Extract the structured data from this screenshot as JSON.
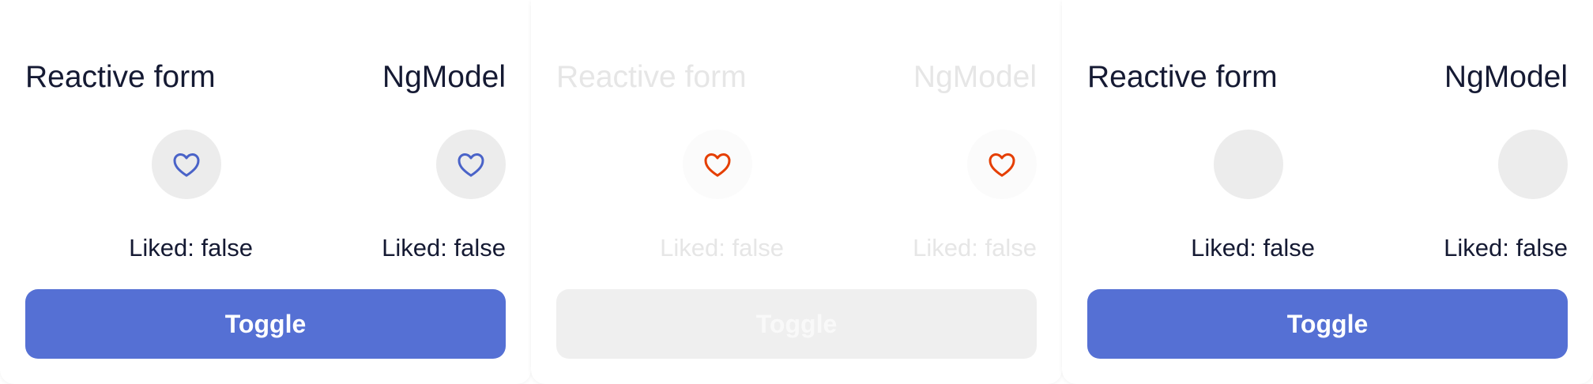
{
  "panels": [
    {
      "state": "enabled",
      "left_heading": "Reactive form",
      "right_heading": "NgModel",
      "left_status": "Liked: false",
      "right_status": "Liked: false",
      "left_icon": "heart-outline-icon",
      "right_icon": "heart-outline-icon",
      "toggle_label": "Toggle"
    },
    {
      "state": "disabled",
      "left_heading": "Reactive form",
      "right_heading": "NgModel",
      "left_status": "Liked: false",
      "right_status": "Liked: false",
      "left_icon": "heart-outline-icon",
      "right_icon": "heart-outline-icon",
      "toggle_label": "Toggle"
    },
    {
      "state": "enabled",
      "left_heading": "Reactive form",
      "right_heading": "NgModel",
      "left_status": "Liked: false",
      "right_status": "Liked: false",
      "left_icon": "",
      "right_icon": "",
      "toggle_label": "Toggle"
    }
  ],
  "colors": {
    "accent": "#5570d4",
    "text": "#151a33",
    "heart_blue": "#4a63c8",
    "heart_red": "#e53e00",
    "button_bg": "#ececec",
    "disabled_bg": "#efefef"
  }
}
